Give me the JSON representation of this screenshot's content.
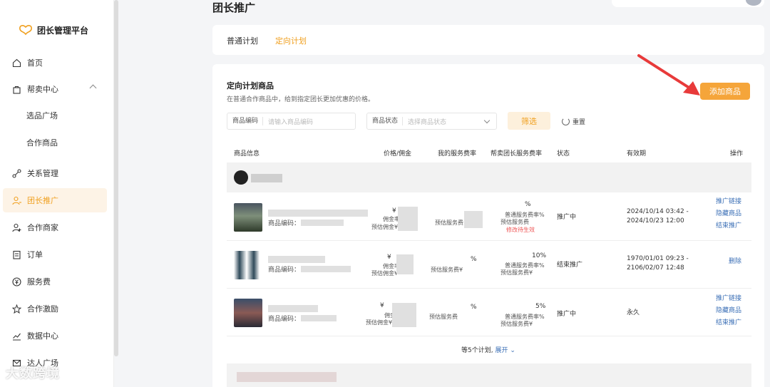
{
  "app": {
    "name": "团长管理平台",
    "colors": {
      "accent": "#f5a53a",
      "link": "#3b6fb6",
      "active_bg": "#fdf3e6"
    }
  },
  "sidebar": {
    "items": [
      {
        "label": "首页",
        "icon": "home-icon"
      },
      {
        "label": "帮卖中心",
        "icon": "bag-icon"
      },
      {
        "label": "选品广场",
        "icon": ""
      },
      {
        "label": "合作商品",
        "icon": ""
      },
      {
        "label": "关系管理",
        "icon": "relation-icon"
      },
      {
        "label": "团长推广",
        "icon": "user-promote-icon"
      },
      {
        "label": "合作商家",
        "icon": "merchant-icon"
      },
      {
        "label": "订单",
        "icon": "order-icon"
      },
      {
        "label": "服务费",
        "icon": "yen-icon"
      },
      {
        "label": "合作激励",
        "icon": "star-icon"
      },
      {
        "label": "数据中心",
        "icon": "chart-icon"
      },
      {
        "label": "达人广场",
        "icon": "mail-icon"
      }
    ]
  },
  "header": {
    "title": "团长推广"
  },
  "tabs": [
    {
      "label": "普通计划"
    },
    {
      "label": "定向计划"
    }
  ],
  "section": {
    "title": "定向计划商品",
    "desc": "在普通合作商品中，给到指定团长更加优惠的价格。",
    "add_button": "添加商品"
  },
  "filters": {
    "code_label": "商品编码",
    "code_placeholder": "请输入商品编码",
    "status_label": "商品状态",
    "status_placeholder": "选择商品状态",
    "filter_button": "筛选",
    "reset": "重置"
  },
  "table": {
    "headers": [
      "商品信息",
      "价格/佣金",
      "我的服务费率",
      "帮卖团长服务费率",
      "状态",
      "有效期",
      "操作"
    ],
    "rows": [
      {
        "code_label": "商品编码：",
        "price": "¥",
        "commission": "佣金率",
        "est_commission": "预估佣金¥",
        "my_fee": "预估服务费",
        "help_rate": "%",
        "help_normal": "普通服务费率%",
        "help_est": "预估服务费",
        "modify": "修改待生效",
        "status": "推广中",
        "valid_start": "2024/10/14 03:42 -",
        "valid_end": "2024/10/23 12:00",
        "ops": [
          "推广链接",
          "隐藏商品",
          "结束推广"
        ]
      },
      {
        "code_label": "商品编码：",
        "price": "¥",
        "commission": "佣金率",
        "est_commission": "预估佣金¥",
        "my_fee_rate": "%",
        "my_fee": "预估服务费¥",
        "help_rate": "10%",
        "help_normal": "普通服务费率%",
        "help_est": "预估服务费¥",
        "status": "结束推广",
        "valid_start": "1970/01/01 09:23 -",
        "valid_end": "2106/02/07 12:48",
        "ops": [
          "删除"
        ]
      },
      {
        "code_label": "商品编码：",
        "price": "¥",
        "commission": "佣金率10%",
        "est_commission": "预估佣金¥",
        "my_fee_rate": "%",
        "my_fee": "预估服务费",
        "help_rate": "5%",
        "help_normal": "普通服务费率%",
        "help_est": "预估服务费¥",
        "status": "推广中",
        "valid_start": "永久",
        "valid_end": "",
        "ops": [
          "推广链接",
          "隐藏商品",
          "结束推广"
        ]
      }
    ],
    "more_text": "等5个计划,",
    "expand": "展开"
  },
  "watermark": "大数跨境"
}
